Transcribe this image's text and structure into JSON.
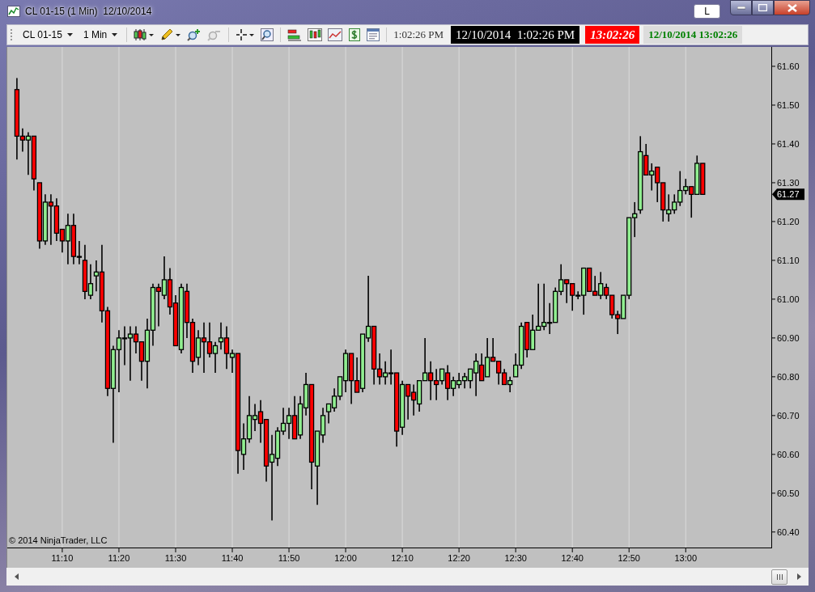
{
  "window": {
    "title": "CL 01-15 (1 Min)  12/10/2014",
    "link_button": "L"
  },
  "toolbar": {
    "instrument": "CL 01-15",
    "interval": "1 Min",
    "time": "1:02:26 PM",
    "clocks": [
      {
        "kind": "dark",
        "text": "12/10/2014  1:02:26 PM"
      },
      {
        "kind": "alert",
        "text": "13:02:26"
      },
      {
        "kind": "plain",
        "text": "12/10/2014 13:02:26"
      }
    ]
  },
  "chart": {
    "copyright": "© 2014 NinjaTrader, LLC",
    "last_price": "61.27",
    "chart_data": {
      "type": "candlestick",
      "grid": true,
      "xlim": [
        660.3,
        795.1
      ],
      "ylim": [
        60.36,
        61.65
      ],
      "x": [
        662,
        663,
        664,
        665,
        666,
        667,
        668,
        669,
        670,
        671,
        672,
        673,
        674,
        675,
        676,
        677,
        678,
        679,
        680,
        681,
        682,
        683,
        684,
        685,
        686,
        687,
        688,
        689,
        690,
        691,
        692,
        693,
        694,
        695,
        696,
        697,
        698,
        699,
        700,
        701,
        702,
        703,
        704,
        705,
        706,
        707,
        708,
        709,
        710,
        711,
        712,
        713,
        714,
        715,
        716,
        717,
        718,
        719,
        720,
        721,
        722,
        723,
        724,
        725,
        726,
        727,
        728,
        729,
        730,
        731,
        732,
        733,
        734,
        735,
        736,
        737,
        738,
        739,
        740,
        741,
        742,
        743,
        744,
        745,
        746,
        747,
        748,
        749,
        750,
        751,
        752,
        753,
        754,
        755,
        756,
        757,
        758,
        759,
        760,
        761,
        762,
        763,
        764,
        765,
        766,
        767,
        768,
        769,
        770,
        771,
        772,
        773,
        774,
        775,
        776,
        777,
        778,
        779,
        780,
        781,
        782,
        783
      ],
      "yticks": [
        {
          "value": 60.4,
          "label": "60.40"
        },
        {
          "value": 60.5,
          "label": "60.50"
        },
        {
          "value": 60.6,
          "label": "60.60"
        },
        {
          "value": 60.7,
          "label": "60.70"
        },
        {
          "value": 60.8,
          "label": "60.80"
        },
        {
          "value": 60.9,
          "label": "60.90"
        },
        {
          "value": 61.0,
          "label": "61.00"
        },
        {
          "value": 61.1,
          "label": "61.10"
        },
        {
          "value": 61.2,
          "label": "61.20"
        },
        {
          "value": 61.3,
          "label": "61.30"
        },
        {
          "value": 61.4,
          "label": "61.40"
        },
        {
          "value": 61.5,
          "label": "61.50"
        },
        {
          "value": 61.6,
          "label": "61.60"
        }
      ],
      "xticks": [
        {
          "value": 670,
          "label": "11:10"
        },
        {
          "value": 680,
          "label": "11:20"
        },
        {
          "value": 690,
          "label": "11:30"
        },
        {
          "value": 700,
          "label": "11:40"
        },
        {
          "value": 710,
          "label": "11:50"
        },
        {
          "value": 720,
          "label": "12:00"
        },
        {
          "value": 730,
          "label": "12:10"
        },
        {
          "value": 740,
          "label": "12:20"
        },
        {
          "value": 750,
          "label": "12:30"
        },
        {
          "value": 760,
          "label": "12:40"
        },
        {
          "value": 770,
          "label": "12:50"
        },
        {
          "value": 780,
          "label": "13:00"
        }
      ],
      "ohlc": [
        [
          61.54,
          61.57,
          61.36,
          61.42
        ],
        [
          61.42,
          61.44,
          61.38,
          61.41
        ],
        [
          61.41,
          61.43,
          61.32,
          61.42
        ],
        [
          61.42,
          61.42,
          61.28,
          61.31
        ],
        [
          61.3,
          61.3,
          61.13,
          61.15
        ],
        [
          61.15,
          61.27,
          61.14,
          61.25
        ],
        [
          61.25,
          61.27,
          61.14,
          61.24
        ],
        [
          61.24,
          61.26,
          61.15,
          61.17
        ],
        [
          61.18,
          61.18,
          61.12,
          61.15
        ],
        [
          61.15,
          61.22,
          61.09,
          61.19
        ],
        [
          61.19,
          61.22,
          61.09,
          61.11
        ],
        [
          61.11,
          61.15,
          61.09,
          61.11
        ],
        [
          61.1,
          61.14,
          61.0,
          61.02
        ],
        [
          61.01,
          61.09,
          61.0,
          61.04
        ],
        [
          61.06,
          61.1,
          61.02,
          61.07
        ],
        [
          61.07,
          61.14,
          60.94,
          60.97
        ],
        [
          60.97,
          60.98,
          60.75,
          60.77
        ],
        [
          60.77,
          60.88,
          60.63,
          60.87
        ],
        [
          60.87,
          60.92,
          60.76,
          60.9
        ],
        [
          60.9,
          60.93,
          60.83,
          60.9
        ],
        [
          60.9,
          60.93,
          60.79,
          60.91
        ],
        [
          60.91,
          60.93,
          60.86,
          60.89
        ],
        [
          60.89,
          60.89,
          60.79,
          60.84
        ],
        [
          60.84,
          60.95,
          60.77,
          60.92
        ],
        [
          60.92,
          61.04,
          60.88,
          61.03
        ],
        [
          61.03,
          61.04,
          60.93,
          61.02
        ],
        [
          61.01,
          61.11,
          61.0,
          61.05
        ],
        [
          61.05,
          61.08,
          60.96,
          60.98
        ],
        [
          60.99,
          61.01,
          60.88,
          60.88
        ],
        [
          60.87,
          61.04,
          60.86,
          61.03
        ],
        [
          61.02,
          61.04,
          60.9,
          60.94
        ],
        [
          60.94,
          60.95,
          60.81,
          60.84
        ],
        [
          60.85,
          60.92,
          60.83,
          60.9
        ],
        [
          60.9,
          60.94,
          60.81,
          60.89
        ],
        [
          60.89,
          60.94,
          60.85,
          60.86
        ],
        [
          60.86,
          60.89,
          60.81,
          60.88
        ],
        [
          60.89,
          60.94,
          60.87,
          60.9
        ],
        [
          60.9,
          60.93,
          60.82,
          60.86
        ],
        [
          60.85,
          60.87,
          60.81,
          60.86
        ],
        [
          60.86,
          60.86,
          60.55,
          60.61
        ],
        [
          60.6,
          60.68,
          60.56,
          60.64
        ],
        [
          60.64,
          60.75,
          60.63,
          60.7
        ],
        [
          60.69,
          60.73,
          60.66,
          60.7
        ],
        [
          60.71,
          60.74,
          60.63,
          60.68
        ],
        [
          60.69,
          60.69,
          60.53,
          60.57
        ],
        [
          60.58,
          60.65,
          60.43,
          60.6
        ],
        [
          60.59,
          60.67,
          60.57,
          60.66
        ],
        [
          60.66,
          60.72,
          60.65,
          60.68
        ],
        [
          60.68,
          60.72,
          60.64,
          60.7
        ],
        [
          60.7,
          60.75,
          60.64,
          60.64
        ],
        [
          60.65,
          60.75,
          60.64,
          60.73
        ],
        [
          60.72,
          60.81,
          60.7,
          60.78
        ],
        [
          60.78,
          60.78,
          60.51,
          60.58
        ],
        [
          60.57,
          60.66,
          60.47,
          60.66
        ],
        [
          60.65,
          60.72,
          60.63,
          60.7
        ],
        [
          60.71,
          60.73,
          60.68,
          60.73
        ],
        [
          60.72,
          60.77,
          60.71,
          60.75
        ],
        [
          60.75,
          60.8,
          60.74,
          60.8
        ],
        [
          60.79,
          60.87,
          60.76,
          60.86
        ],
        [
          60.86,
          60.86,
          60.73,
          60.79
        ],
        [
          60.79,
          60.85,
          60.76,
          60.76
        ],
        [
          60.77,
          60.91,
          60.76,
          60.91
        ],
        [
          60.9,
          61.06,
          60.89,
          60.93
        ],
        [
          60.93,
          60.93,
          60.78,
          60.82
        ],
        [
          60.82,
          60.86,
          60.78,
          60.8
        ],
        [
          60.8,
          60.84,
          60.78,
          60.81
        ],
        [
          60.81,
          60.87,
          60.78,
          60.81
        ],
        [
          60.81,
          60.81,
          60.62,
          60.66
        ],
        [
          60.67,
          60.79,
          60.65,
          60.78
        ],
        [
          60.78,
          60.78,
          60.69,
          60.75
        ],
        [
          60.76,
          60.78,
          60.7,
          60.74
        ],
        [
          60.73,
          60.79,
          60.71,
          60.79
        ],
        [
          60.79,
          60.9,
          60.79,
          60.81
        ],
        [
          60.81,
          60.84,
          60.74,
          60.79
        ],
        [
          60.79,
          60.82,
          60.74,
          60.78
        ],
        [
          60.79,
          60.82,
          60.78,
          60.82
        ],
        [
          60.81,
          60.83,
          60.74,
          60.77
        ],
        [
          60.77,
          60.8,
          60.75,
          60.79
        ],
        [
          60.78,
          60.81,
          60.77,
          60.79
        ],
        [
          60.79,
          60.81,
          60.77,
          60.8
        ],
        [
          60.79,
          60.82,
          60.77,
          60.82
        ],
        [
          60.81,
          60.86,
          60.75,
          60.84
        ],
        [
          60.83,
          60.86,
          60.79,
          60.79
        ],
        [
          60.8,
          60.9,
          60.8,
          60.85
        ],
        [
          60.85,
          60.9,
          60.84,
          60.84
        ],
        [
          60.84,
          60.84,
          60.78,
          60.81
        ],
        [
          60.81,
          60.82,
          60.78,
          60.78
        ],
        [
          60.78,
          60.8,
          60.76,
          60.79
        ],
        [
          60.8,
          60.86,
          60.8,
          60.83
        ],
        [
          60.83,
          60.94,
          60.82,
          60.93
        ],
        [
          60.94,
          60.94,
          60.85,
          60.87
        ],
        [
          60.87,
          60.96,
          60.87,
          60.92
        ],
        [
          60.92,
          61.04,
          60.92,
          60.93
        ],
        [
          60.93,
          61.04,
          60.92,
          60.94
        ],
        [
          60.94,
          60.99,
          60.91,
          60.94
        ],
        [
          60.94,
          61.03,
          60.94,
          61.02
        ],
        [
          61.02,
          61.09,
          61.01,
          61.05
        ],
        [
          61.05,
          61.05,
          60.99,
          61.04
        ],
        [
          61.04,
          61.04,
          60.97,
          61.01
        ],
        [
          61.01,
          61.02,
          61.0,
          61.01
        ],
        [
          61.01,
          61.08,
          60.96,
          61.08
        ],
        [
          61.08,
          61.08,
          61.02,
          61.02
        ],
        [
          61.02,
          61.06,
          61.01,
          61.01
        ],
        [
          61.01,
          61.07,
          61.0,
          61.04
        ],
        [
          61.03,
          61.04,
          61.0,
          61.01
        ],
        [
          61.01,
          61.01,
          60.95,
          60.96
        ],
        [
          60.96,
          60.97,
          60.91,
          60.95
        ],
        [
          60.95,
          61.01,
          60.95,
          61.01
        ],
        [
          61.01,
          61.21,
          61.0,
          61.21
        ],
        [
          61.21,
          61.25,
          61.16,
          61.22
        ],
        [
          61.23,
          61.42,
          61.22,
          61.38
        ],
        [
          61.37,
          61.4,
          61.32,
          61.32
        ],
        [
          61.32,
          61.35,
          61.28,
          61.33
        ],
        [
          61.34,
          61.34,
          61.25,
          61.3
        ],
        [
          61.3,
          61.3,
          61.2,
          61.23
        ],
        [
          61.22,
          61.27,
          61.2,
          61.23
        ],
        [
          61.23,
          61.27,
          61.22,
          61.25
        ],
        [
          61.25,
          61.33,
          61.24,
          61.28
        ],
        [
          61.28,
          61.31,
          61.27,
          61.29
        ],
        [
          61.29,
          61.29,
          61.21,
          61.27
        ],
        [
          61.27,
          61.37,
          61.27,
          61.35
        ],
        [
          61.35,
          61.35,
          61.27,
          61.27
        ]
      ]
    }
  }
}
